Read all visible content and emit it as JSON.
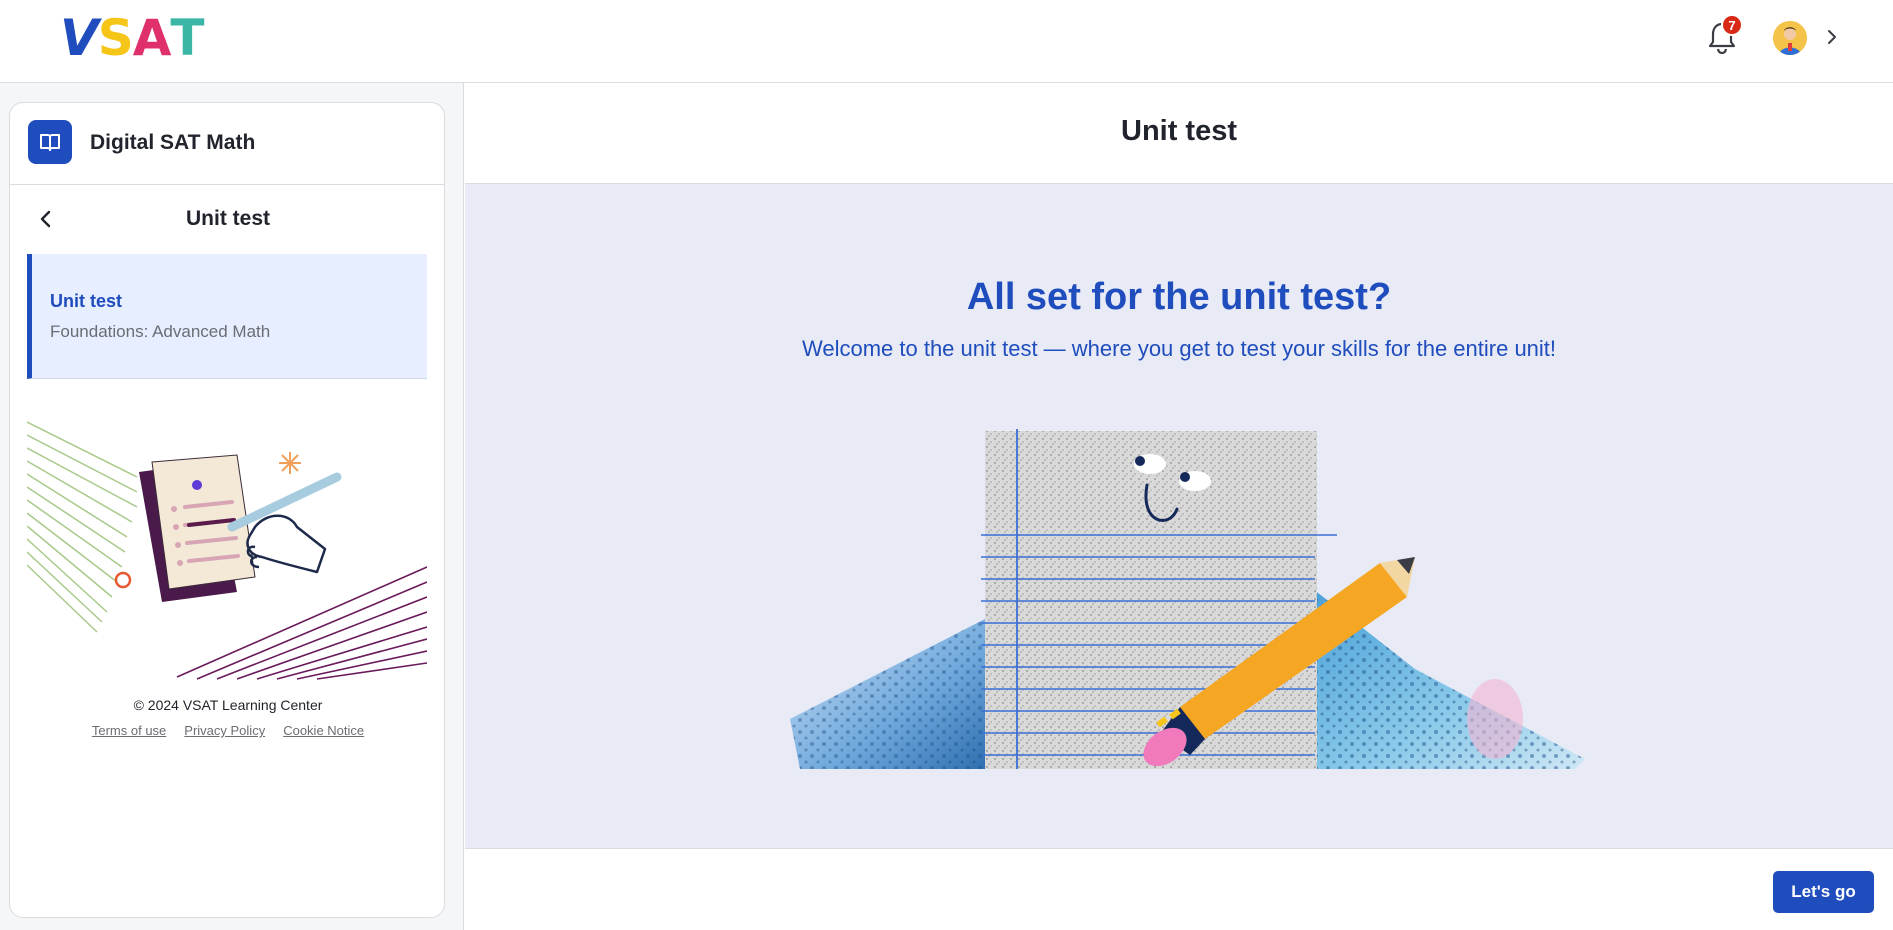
{
  "header": {
    "logo": {
      "letters": [
        "V",
        "S",
        "A",
        "T"
      ],
      "colors": [
        "#1f4dbd",
        "#f5c518",
        "#e0306b",
        "#3bb5a5"
      ]
    },
    "notifications": {
      "count": "7",
      "icon": "bell-icon"
    },
    "avatar": {
      "icon": "user-avatar"
    },
    "menu_icon": "chevron-right-icon"
  },
  "sidebar": {
    "course_title": "Digital SAT Math",
    "course_icon": "book-icon",
    "section_title": "Unit test",
    "lesson": {
      "title": "Unit test",
      "subtitle": "Foundations: Advanced Math"
    },
    "copyright": "© 2024 VSAT Learning Center",
    "footer_links": [
      "Terms of use",
      "Privacy Policy",
      "Cookie Notice"
    ]
  },
  "main": {
    "title": "Unit test",
    "headline": "All set for the unit test?",
    "subline": "Welcome to the unit test — where you get to test your skills for the entire unit!",
    "cta_label": "Let's go"
  },
  "colors": {
    "accent": "#1f4dbd",
    "stage_bg": "#e8eaf6",
    "badge": "#d92916",
    "lesson_bg": "#e6eeff"
  }
}
